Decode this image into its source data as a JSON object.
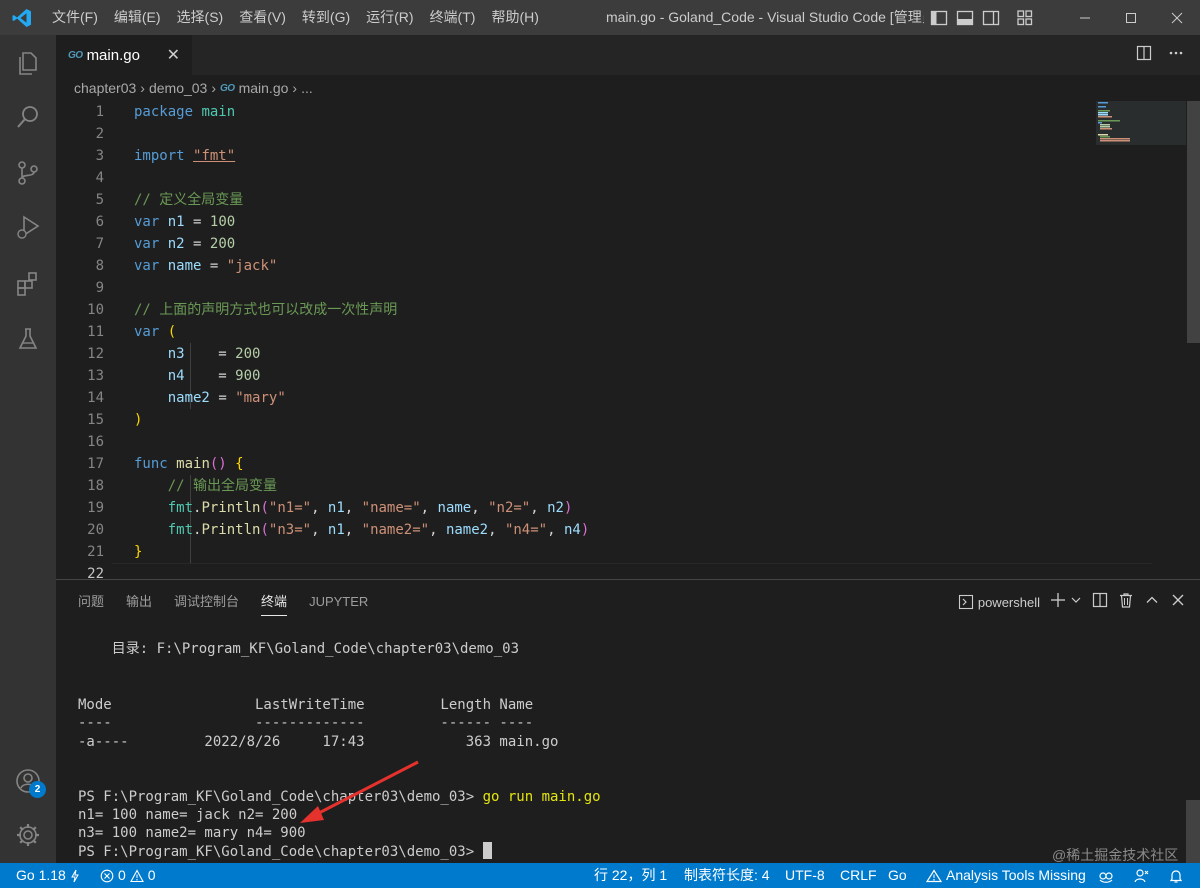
{
  "menu": [
    "文件(F)",
    "编辑(E)",
    "选择(S)",
    "查看(V)",
    "转到(G)",
    "运行(R)",
    "终端(T)",
    "帮助(H)"
  ],
  "window_title": "main.go - Goland_Code - Visual Studio Code [管理员]",
  "tab": {
    "badge": "GO",
    "label": "main.go",
    "close": "✕"
  },
  "breadcrumb": {
    "folder1": "chapter03",
    "folder2": "demo_03",
    "badge": "GO",
    "file": "main.go",
    "more": "..."
  },
  "line_numbers": [
    "1",
    "2",
    "3",
    "4",
    "5",
    "6",
    "7",
    "8",
    "9",
    "10",
    "11",
    "12",
    "13",
    "14",
    "15",
    "16",
    "17",
    "18",
    "19",
    "20",
    "21",
    "22"
  ],
  "code": {
    "l1": {
      "kw": "package",
      "name": "main"
    },
    "l3": {
      "kw": "import",
      "str": "\"fmt\""
    },
    "l5": "// 定义全局变量",
    "l6": {
      "kw": "var",
      "name": "n1",
      "op": "=",
      "num": "100"
    },
    "l7": {
      "kw": "var",
      "name": "n2",
      "op": "=",
      "num": "200"
    },
    "l8": {
      "kw": "var",
      "name": "name",
      "op": "=",
      "str": "\"jack\""
    },
    "l10": "// 上面的声明方式也可以改成一次性声明",
    "l11": {
      "kw": "var",
      "br": "("
    },
    "l12": {
      "name": "n3",
      "op": "=",
      "num": "200"
    },
    "l13": {
      "name": "n4",
      "op": "=",
      "num": "900"
    },
    "l14": {
      "name": "name2",
      "op": "=",
      "str": "\"mary\""
    },
    "l15": {
      "br": ")"
    },
    "l17": {
      "kw": "func",
      "fn": "main",
      "parens": "()",
      "br": "{"
    },
    "l18": "// 输出全局变量",
    "l19": {
      "pkg": "fmt",
      "fn": "Println",
      "s1": "\"n1=\"",
      "a1": "n1",
      "s2": "\"name=\"",
      "a2": "name",
      "s3": "\"n2=\"",
      "a3": "n2"
    },
    "l20": {
      "pkg": "fmt",
      "fn": "Println",
      "s1": "\"n3=\"",
      "a1": "n1",
      "s2": "\"name2=\"",
      "a2": "name2",
      "s3": "\"n4=\"",
      "a3": "n4"
    },
    "l21": {
      "br": "}"
    }
  },
  "panel": {
    "tabs": [
      "问题",
      "输出",
      "调试控制台",
      "终端",
      "JUPYTER"
    ],
    "active_tab": "终端",
    "shell": "powershell",
    "terminal": {
      "dir": "    目录: F:\\Program_KF\\Goland_Code\\chapter03\\demo_03",
      "header": "Mode                 LastWriteTime         Length Name",
      "dashes": "----                 -------------         ------ ----",
      "row": "-a----         2022/8/26     17:43            363 main.go",
      "prompt": "PS F:\\Program_KF\\Goland_Code\\chapter03\\demo_03> ",
      "cmd": "go run main.go",
      "out1": "n1= 100 name= jack n2= 200",
      "out2": "n3= 100 name2= mary n4= 900",
      "prompt2": "PS F:\\Program_KF\\Goland_Code\\chapter03\\demo_03> "
    }
  },
  "status": {
    "go_version": "Go 1.18",
    "errors": "0",
    "warnings": "0",
    "position": "行 22，列 1",
    "indent": "制表符长度: 4",
    "encoding": "UTF-8",
    "eol": "CRLF",
    "language": "Go",
    "analysis": "Analysis Tools Missing"
  },
  "accounts_badge": "2",
  "watermark": "@稀土掘金技术社区",
  "colors": {
    "statusbar": "#007acc",
    "keyword": "#569cd6",
    "string": "#ce9178",
    "number": "#b5cea8",
    "comment": "#6a9955"
  }
}
